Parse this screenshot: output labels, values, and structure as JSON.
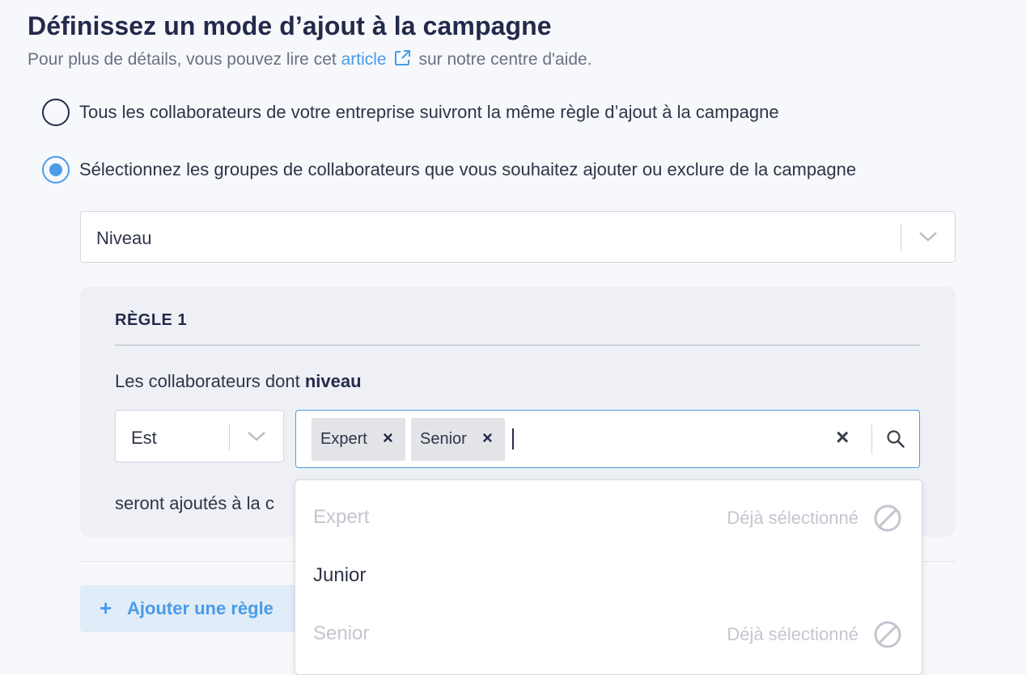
{
  "header": {
    "title": "Définissez un mode d’ajout à la campagne",
    "subtitle_before": "Pour plus de détails, vous pouvez lire cet",
    "link_text": "article",
    "subtitle_after": "sur notre centre d'aide.",
    "link_icon": "external-link-icon"
  },
  "mode_options": [
    {
      "label": "Tous les collaborateurs de votre entreprise suivront la même règle d’ajout à la campagne",
      "selected": false
    },
    {
      "label": "Sélectionnez les groupes de collaborateurs que vous souhaitez ajouter ou exclure de la campagne",
      "selected": true
    }
  ],
  "group_select": {
    "value": "Niveau"
  },
  "rule": {
    "title": "RÈGLE 1",
    "text_prefix": "Les collaborateurs dont",
    "text_attribute": "niveau",
    "operator": "Est",
    "selected_tags": [
      "Expert",
      "Senior"
    ],
    "text_after": "seront ajoutés à la c"
  },
  "add_rule_label": "Ajouter une règle",
  "dropdown_options": [
    {
      "label": "Expert",
      "status": "Déjà sélectionné",
      "disabled": true
    },
    {
      "label": "Junior",
      "status": "",
      "disabled": false
    },
    {
      "label": "Senior",
      "status": "Déjà sélectionné",
      "disabled": true
    }
  ],
  "colors": {
    "accent": "#4a9be8",
    "heading": "#232a4a",
    "muted": "#c3c6cf",
    "card_bg": "#eef0f5"
  }
}
